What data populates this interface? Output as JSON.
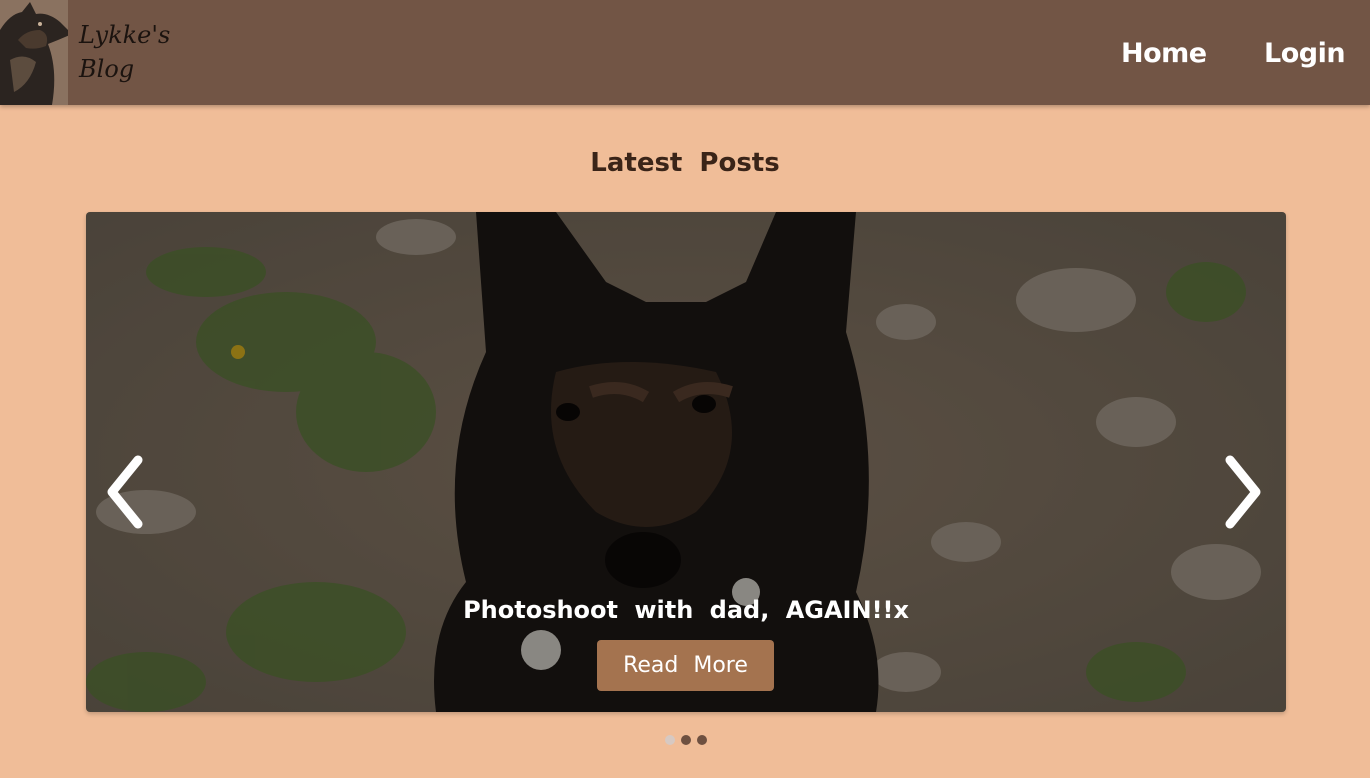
{
  "navbar": {
    "logo_text": "Lykke's Blog",
    "links": [
      {
        "label": "Home"
      },
      {
        "label": "Login"
      }
    ]
  },
  "main": {
    "section_title": "Latest Posts",
    "carousel": {
      "slide_caption": "Photoshoot with dad, AGAIN!!x",
      "button_label": "Read More",
      "prev_icon": "chevron-left-icon",
      "next_icon": "chevron-right-icon",
      "indicator_count": 3,
      "active_indicator": 1
    }
  },
  "colors": {
    "navbar_bg": "#725545",
    "page_bg": "#f0bd98",
    "button_bg": "#a4734f",
    "title_text": "#3a2418"
  }
}
